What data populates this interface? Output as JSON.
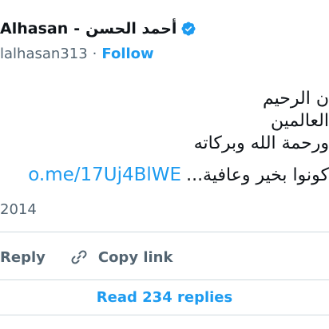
{
  "author": {
    "display_name_latin": "Alhasan",
    "separator": "-",
    "display_name_arabic": "أحمد الحسن",
    "handle": "lalhasan313",
    "separator_dot": "·",
    "follow_label": "Follow",
    "verified_icon": "verified-badge-icon"
  },
  "tweet": {
    "lines": [
      "ن الرحيم",
      "العالمين",
      "ورحمة الله وبركاته"
    ],
    "link": "o.me/17Uj4BlWE",
    "last_line_tail": "كونوا بخير وعافية...",
    "date": "2014"
  },
  "actions": {
    "reply_label": "Reply",
    "copy_link_label": "Copy link"
  },
  "read_replies_label": "Read 234 replies",
  "colors": {
    "accent": "#1d9bf0",
    "text": "#0f1419",
    "muted": "#536471",
    "divider": "#cfd9de"
  }
}
